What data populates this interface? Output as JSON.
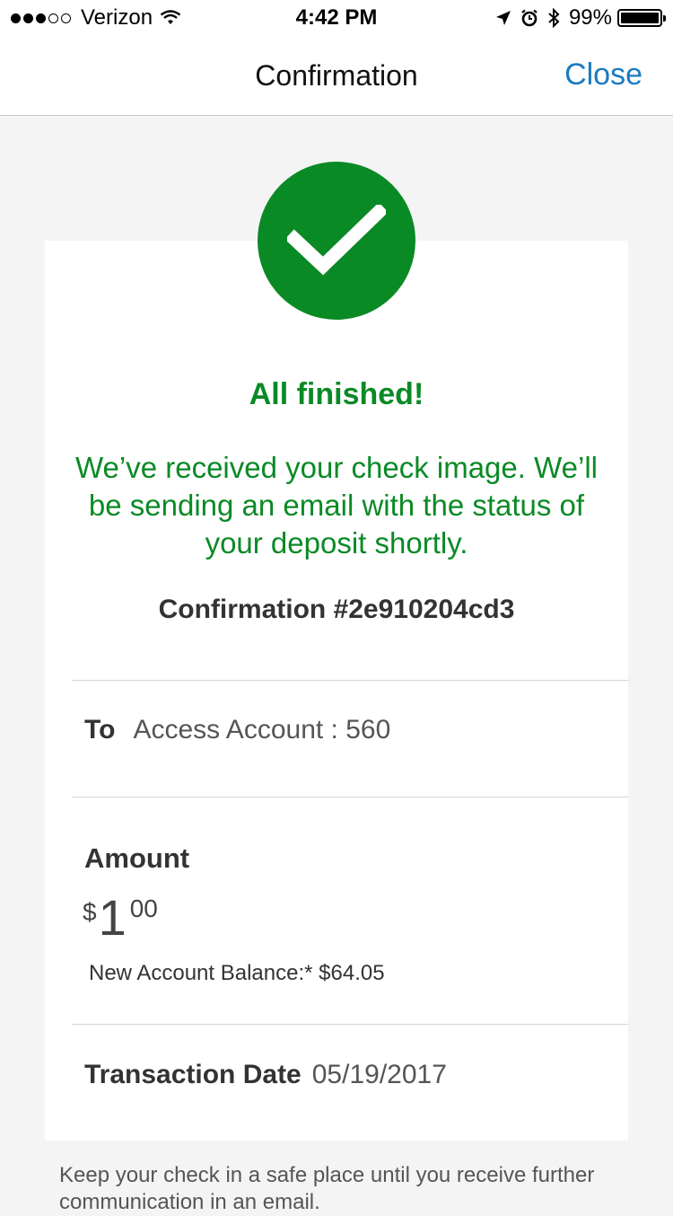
{
  "status_bar": {
    "carrier": "Verizon",
    "time": "4:42 PM",
    "battery": "99%"
  },
  "nav": {
    "title": "Confirmation",
    "close_label": "Close"
  },
  "confirmation": {
    "headline": "All finished!",
    "message": "We’ve received your check image. We’ll be sending an email with the status of your deposit shortly.",
    "number_text": "Confirmation #2e910204cd3"
  },
  "details": {
    "to_label": "To",
    "to_value": "Access Account : 560",
    "amount_label": "Amount",
    "amount_currency": "$",
    "amount_whole": "1",
    "amount_cents": "00",
    "balance_text": "New Account Balance:* $64.05",
    "date_label": "Transaction Date",
    "date_value": "05/19/2017"
  },
  "footnote": "Keep your check in a safe place until you receive further communication in an email.",
  "colors": {
    "success_green": "#0a8a25",
    "link_blue": "#1a7bbf"
  }
}
